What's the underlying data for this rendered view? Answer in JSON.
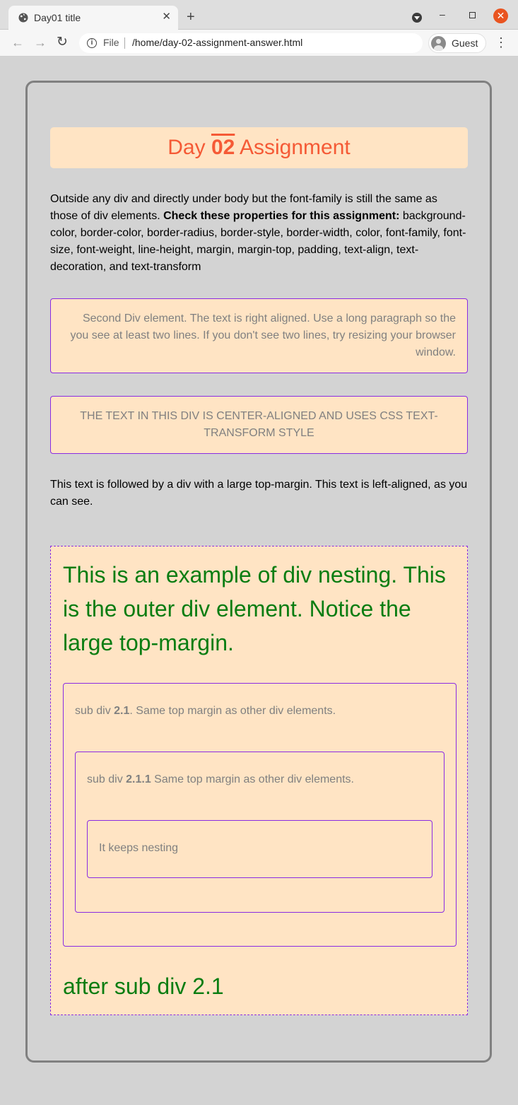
{
  "browser": {
    "tab_title": "Day01 title",
    "tab_close": "✕",
    "new_tab": "+",
    "file_label": "File",
    "url": "/home/day-02-assignment-answer.html",
    "profile_label": "Guest",
    "back": "←",
    "forward": "→",
    "reload": "↻",
    "menu": "⋮",
    "minimize": "–",
    "close": "✕",
    "info": "i"
  },
  "page": {
    "heading": {
      "prefix": "Day ",
      "number": "02",
      "suffix": " Assignment"
    },
    "intro": {
      "text_before": "Outside any div and directly under body but the font-family is still the same as those of div elements. ",
      "bold": "Check these properties for this assignment:",
      "text_after": " background-color, border-color, border-radius, border-style, border-width, color, font-family, font-size, font-weight, line-height, margin, margin-top, padding, text-align, text-decoration, and text-transform"
    },
    "right_aligned_text": "Second Div element. The text is right aligned. Use a long paragraph so the you see at least two lines. If you don't see two lines, try resizing your browser window.",
    "center_text": "THE TEXT IN THIS DIV IS CENTER-ALIGNED AND USES CSS TEXT-TRANSFORM STYLE",
    "follow_text": "This text is followed by a div with a large top-margin. This text is left-aligned, as you can see.",
    "outer_text": "This is an example of div nesting. This is the outer div element. Notice the large top-margin.",
    "sub21": {
      "prefix": "sub div ",
      "bold": "2.1",
      "suffix": ". Same top margin as other div elements."
    },
    "sub211": {
      "prefix": "sub div ",
      "bold": "2.1.1",
      "suffix": " Same top margin as other div elements."
    },
    "sub2111_text": "It keeps nesting",
    "after_text": "after sub div 2.1"
  },
  "colors": {
    "box_background": "#ffe4c4",
    "box_border": "#8a2be2",
    "heading_color": "#f55a36",
    "outer_text_color": "#0a7d12",
    "muted_text": "#808080",
    "page_background": "#d3d3d3"
  },
  "icons": [
    "globe-icon",
    "close-icon",
    "plus-icon",
    "chevron-down-icon",
    "back-arrow-icon",
    "forward-arrow-icon",
    "reload-icon",
    "info-icon",
    "avatar-icon",
    "kebab-menu-icon"
  ]
}
